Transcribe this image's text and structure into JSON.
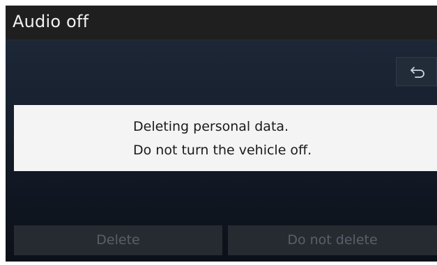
{
  "header": {
    "title": "Audio off"
  },
  "toolbar": {
    "back_icon": "back-arrow-icon"
  },
  "dialog": {
    "line1": "Deleting personal data.",
    "line2": "Do not turn the vehicle off."
  },
  "buttons": {
    "delete_label": "Delete",
    "do_not_delete_label": "Do not delete"
  },
  "colors": {
    "header_bg": "#1f1f1f",
    "dialog_bg": "#f4f4f4",
    "button_bg": "#262a31",
    "button_text_disabled": "#5b6068"
  }
}
